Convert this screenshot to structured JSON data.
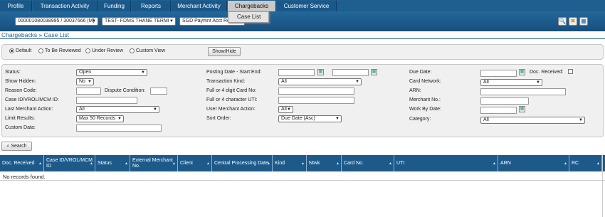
{
  "nav": {
    "tabs": [
      "Profile",
      "Transaction Activity",
      "Funding",
      "Reports",
      "Merchant Activity",
      "Chargebacks",
      "Customer Service"
    ],
    "active": "Chargebacks",
    "dropdown_item": "Case List"
  },
  "bar": {
    "account_select": "000001080038995 / 30037666 (M)",
    "merchant_select": "TEST- FDMS THANE TERMI",
    "currency_select": "SGD Paymnt Acct Re..."
  },
  "breadcrumb": "Chargebacks » Case List",
  "views": {
    "options": [
      "Default",
      "To Be Reviewed",
      "Under Review",
      "Custom View"
    ],
    "selected": "Default",
    "show_hide_label": "Show/Hide"
  },
  "filters": {
    "status_label": "Status:",
    "status_value": "Open",
    "show_hidden_label": "Show Hidden:",
    "show_hidden_value": "No",
    "reason_code_label": "Reason Code:",
    "dispute_condition_label": "Dispute Condition:",
    "case_id_label": "Case ID/VROL/MCM ID:",
    "last_action_label": "Last Merchant Action:",
    "last_action_value": "All",
    "limit_label": "Limit Results:",
    "limit_value": "Max 50 Records",
    "custom_data_label": "Custom Data:",
    "posting_date_label": "Posting Date - Start:End:",
    "transaction_kind_label": "Transaction Kind:",
    "transaction_kind_value": "All",
    "card_no_label": "Full or 4 digit Card No:",
    "uti_label": "Full or 4 character UTI:",
    "user_action_label": "User Merchant Action:",
    "user_action_value": "All",
    "sort_order_label": "Sort Order:",
    "sort_order_value": "Due Date (Asc)",
    "due_date_label": "Due Date:",
    "doc_received_label": "Doc. Received:",
    "card_network_label": "Card Network:",
    "card_network_value": "All",
    "arn_label": "ARN:",
    "merchant_no_label": "Merchant No.:",
    "work_by_date_label": "Work By Date:",
    "category_label": "Category:",
    "category_value": "All"
  },
  "search_label": "Search",
  "table": {
    "columns": [
      "Doc. Received",
      "Case ID/VROL/MCM ID",
      "Status",
      "External Merchant No.",
      "Client",
      "Central Processing Date",
      "Kind",
      "Ntwk",
      "Card No.",
      "UTI",
      "ARN",
      "RC"
    ],
    "empty_message": "No records found."
  },
  "colors": {
    "nav": "#1e5f8f",
    "header_row": "#1d5a8a",
    "active_tab": "#c9c9c9"
  }
}
